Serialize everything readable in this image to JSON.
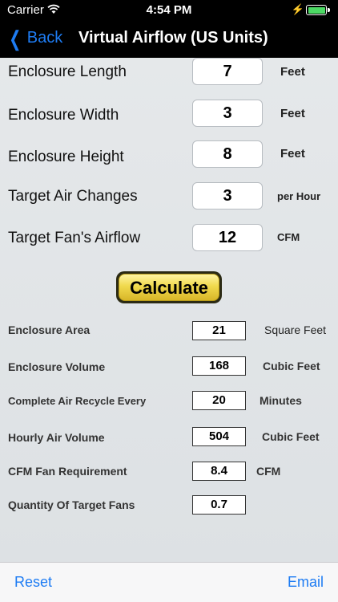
{
  "status_bar": {
    "carrier": "Carrier",
    "time": "4:54 PM",
    "wifi_icon": "wifi-icon",
    "battery_icon": "battery-icon"
  },
  "nav": {
    "back_label": "Back",
    "title": "Virtual Airflow (US Units)"
  },
  "inputs": [
    {
      "label": "Enclosure Length",
      "value": "7",
      "unit": "Feet"
    },
    {
      "label": "Enclosure Width",
      "value": "3",
      "unit": "Feet"
    },
    {
      "label": "Enclosure Height",
      "value": "8",
      "unit": "Feet"
    },
    {
      "label": "Target Air Changes",
      "value": "3",
      "unit": "per Hour"
    },
    {
      "label": "Target Fan's Airflow",
      "value": "12",
      "unit": "CFM"
    }
  ],
  "calculate_label": "Calculate",
  "results": [
    {
      "label": "Enclosure Area",
      "value": "21",
      "unit": "Square Feet"
    },
    {
      "label": "Enclosure Volume",
      "value": "168",
      "unit": "Cubic Feet"
    },
    {
      "label": "Complete Air Recycle Every",
      "value": "20",
      "unit": "Minutes"
    },
    {
      "label": "Hourly Air Volume",
      "value": "504",
      "unit": "Cubic Feet"
    },
    {
      "label": "CFM Fan Requirement",
      "value": "8.4",
      "unit": "CFM"
    },
    {
      "label": "Quantity Of Target Fans",
      "value": "0.7",
      "unit": ""
    }
  ],
  "toolbar": {
    "reset_label": "Reset",
    "email_label": "Email"
  },
  "colors": {
    "accent": "#1e7cf3",
    "button_gold": "#f0d94d",
    "battery_green": "#4cd964"
  }
}
